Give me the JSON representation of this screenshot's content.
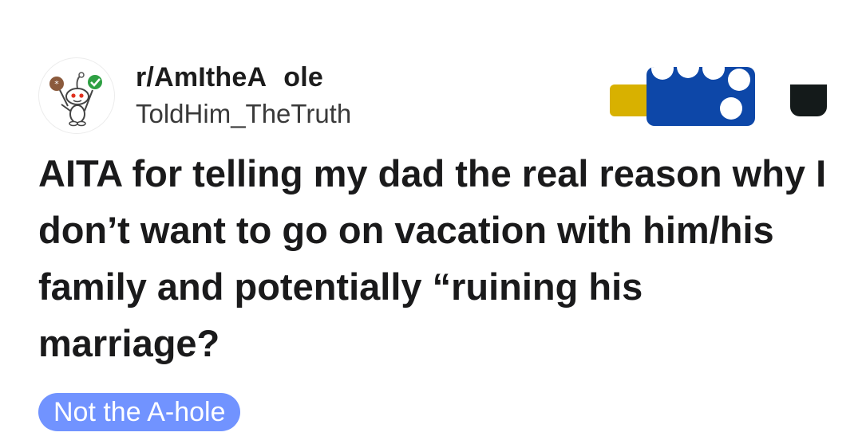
{
  "post": {
    "subreddit": "r/AmItheA   ole",
    "username": "ToldHim_TheTruth",
    "title": "AITA for telling my dad the real reason why I don’t want to go on vacation with him/his family and potentially “ruining his marriage?",
    "flair": "Not the A-hole"
  },
  "icons": {
    "avatar": "reddit-snoo-avatar-icon",
    "awards": [
      "gold-award-icon",
      "blue-award-icon",
      "dark-award-icon"
    ]
  },
  "colors": {
    "flair_background": "#7193ff",
    "award_gold": "#d8b100",
    "award_blue": "#0d47a8",
    "award_dark": "#141a1a"
  }
}
